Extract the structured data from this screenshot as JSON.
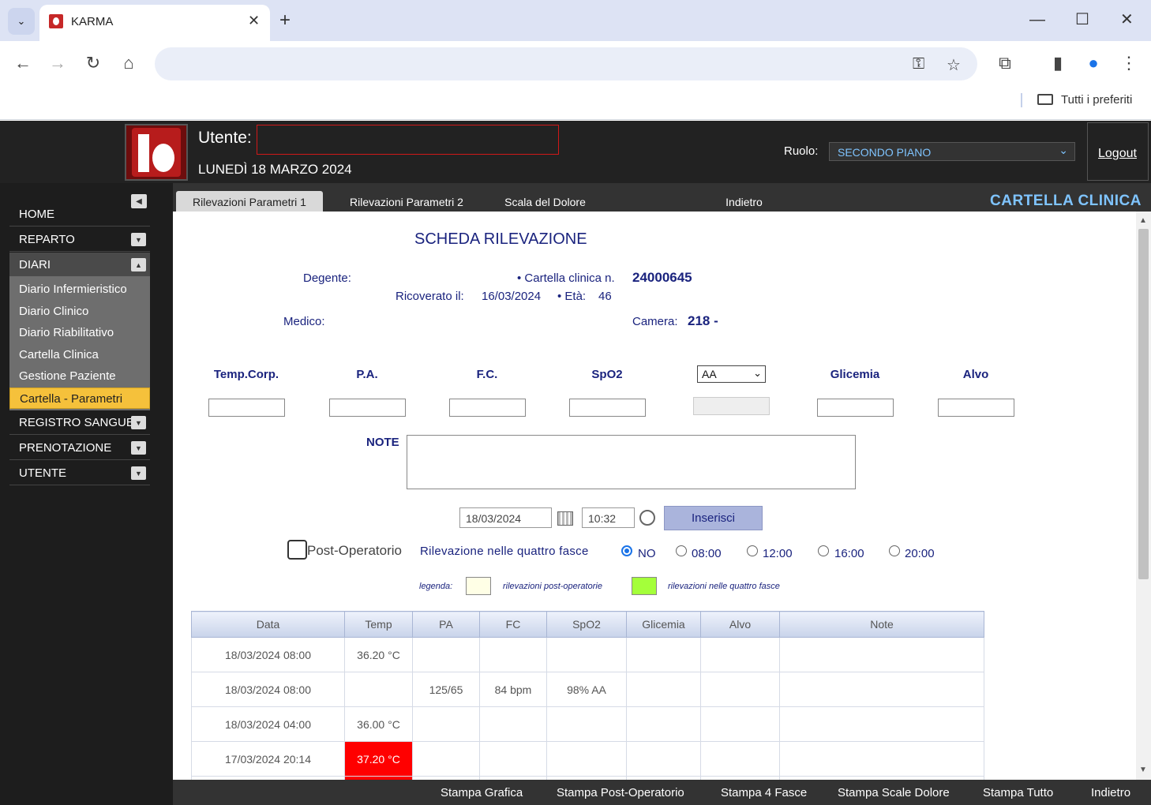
{
  "browser": {
    "tab_title": "KARMA",
    "bookmark_label": "Tutti i preferiti"
  },
  "header": {
    "user_label": "Utente:",
    "date": "LUNEDÌ 18 MARZO 2024",
    "role_label": "Ruolo:",
    "role_value": "SECONDO PIANO",
    "logout": "Logout"
  },
  "sidebar": {
    "items": [
      {
        "label": "HOME"
      },
      {
        "label": "REPARTO"
      },
      {
        "label": "DIARI"
      },
      {
        "label": "REGISTRO SANGUE"
      },
      {
        "label": "PRENOTAZIONE"
      },
      {
        "label": "UTENTE"
      }
    ],
    "submenu": [
      {
        "label": "Diario Infermieristico"
      },
      {
        "label": "Diario Clinico"
      },
      {
        "label": "Diario Riabilitativo"
      },
      {
        "label": "Cartella Clinica"
      },
      {
        "label": "Gestione Paziente"
      },
      {
        "label": "Cartella - Parametri"
      }
    ]
  },
  "tabs": [
    {
      "label": "Rilevazioni Parametri 1"
    },
    {
      "label": "Rilevazioni Parametri 2"
    },
    {
      "label": "Scala del Dolore"
    },
    {
      "label": "Indietro"
    }
  ],
  "section_title": "CARTELLA  CLINICA",
  "scheda": {
    "title": "SCHEDA RILEVAZIONE",
    "degente_label": "Degente:",
    "cartella_label": "• Cartella clinica n.",
    "cartella_number": "24000645",
    "ricoverato_label": "Ricoverato il:",
    "ricoverato_date": "16/03/2024",
    "eta_label": "• Età:",
    "eta_value": "46",
    "medico_label": "Medico:",
    "camera_label": "Camera:",
    "camera_value": "218 -"
  },
  "params": {
    "temp": "Temp.Corp.",
    "pa": "P.A.",
    "fc": "F.C.",
    "spo2": "SpO2",
    "spo2_mode": "AA",
    "glicemia": "Glicemia",
    "alvo": "Alvo",
    "note": "NOTE"
  },
  "entry": {
    "date": "18/03/2024",
    "time": "10:32",
    "submit": "Inserisci",
    "post_operatorio": "Post-Operatorio",
    "fasce_label": "Rilevazione nelle quattro fasce",
    "options": [
      "NO",
      "08:00",
      "12:00",
      "16:00",
      "20:00"
    ],
    "selected": "NO"
  },
  "legend": {
    "label": "legenda:",
    "post_op": "rilevazioni post-operatorie",
    "fasce": "rilevazioni nelle quattro fasce",
    "post_op_color": "#ffffe6",
    "fasce_color": "#a4ff3a"
  },
  "table": {
    "columns": [
      "Data",
      "Temp",
      "PA",
      "FC",
      "SpO2",
      "Glicemia",
      "Alvo",
      "Note"
    ],
    "rows": [
      {
        "data": "18/03/2024 08:00",
        "temp": "36.20 °C",
        "pa": "",
        "fc": "",
        "spo2": "",
        "glicemia": "",
        "alvo": "",
        "note": ""
      },
      {
        "data": "18/03/2024 08:00",
        "temp": "",
        "pa": "125/65",
        "fc": "84 bpm",
        "spo2": "98% AA",
        "glicemia": "",
        "alvo": "",
        "note": ""
      },
      {
        "data": "18/03/2024 04:00",
        "temp": "36.00 °C",
        "pa": "",
        "fc": "",
        "spo2": "",
        "glicemia": "",
        "alvo": "",
        "note": ""
      },
      {
        "data": "17/03/2024 20:14",
        "temp": "37.20 °C",
        "pa": "",
        "fc": "",
        "spo2": "",
        "glicemia": "",
        "alvo": "",
        "note": ""
      }
    ],
    "fever_color": "#ff0000"
  },
  "footer": [
    "Stampa Grafica",
    "Stampa Post-Operatorio",
    "Stampa 4 Fasce",
    "Stampa Scale Dolore",
    "Stampa Tutto",
    "Indietro"
  ]
}
